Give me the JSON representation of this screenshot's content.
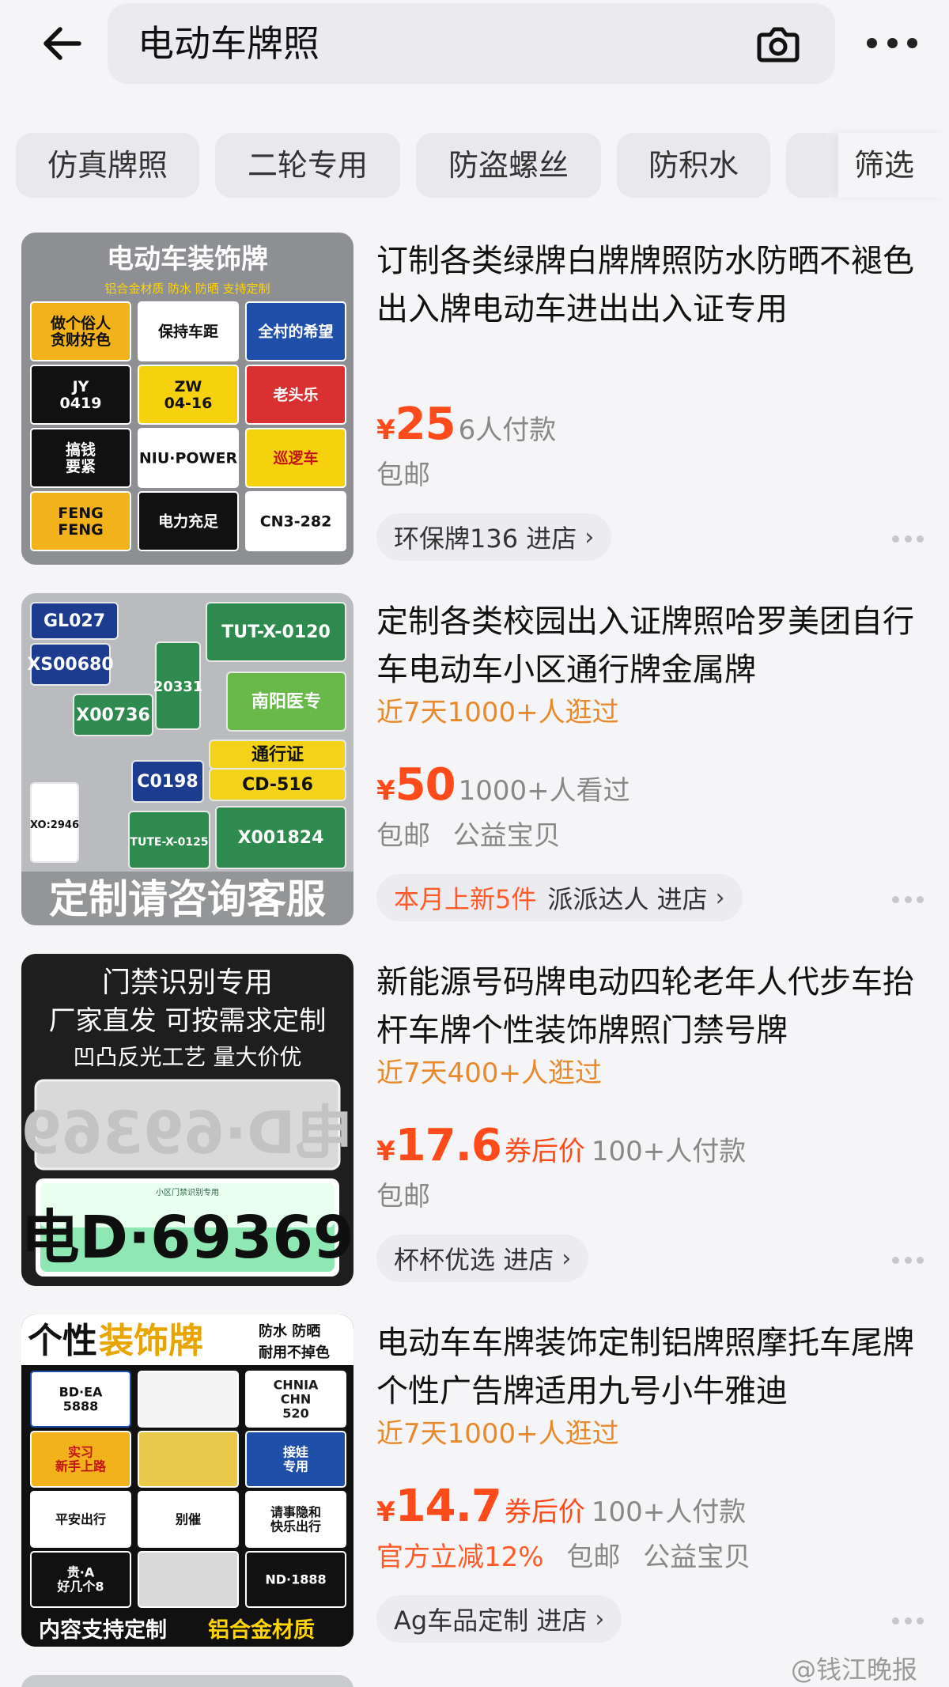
{
  "header": {
    "back_icon": "arrow-left-icon",
    "search_query": "电动车牌照",
    "camera_icon": "camera-icon",
    "more_icon": "more-horizontal-icon"
  },
  "filter_chips": [
    "仿真牌照",
    "二轮专用",
    "防盗螺丝",
    "防积水",
    "筛选"
  ],
  "products": [
    {
      "title": "订制各类绿牌白牌牌照防水防晒不褪色出入牌电动车进出出入证专用",
      "tagline": "",
      "price_yen": "¥",
      "price": "25",
      "coupon_label": "",
      "sales": "6人付款",
      "shipping": [
        "包邮"
      ],
      "shipping_highlight": "",
      "store_highlight": "",
      "store": "环保牌136",
      "store_link": "进店",
      "image": {
        "heading": "电动车装饰牌",
        "subheading": "铝合金材质 防水 防晒 支持定制",
        "plates": [
          "做个俗人 贪财好色",
          "保持车距",
          "全村的希望",
          "JY 0419",
          "ZW 04-16",
          "老头乐",
          "搞钱 要紧",
          "NIU·POWER",
          "巡逻车",
          "FENG FENG",
          "电力充足",
          "CN3-282"
        ]
      }
    },
    {
      "title": "定制各类校园出入证牌照哈罗美团自行车电动车小区通行牌金属牌",
      "tagline": "近7天1000+人逛过",
      "price_yen": "¥",
      "price": "50",
      "coupon_label": "",
      "sales": "1000+人看过",
      "shipping": [
        "包邮",
        "公益宝贝"
      ],
      "shipping_highlight": "",
      "store_highlight": "本月上新5件",
      "store": "派派达人",
      "store_link": "进店",
      "image": {
        "plates": [
          "GL027",
          "XS00680",
          "20331",
          "TUT-X-0120",
          "X00736",
          "南阳医专",
          "通行证",
          "CD-516",
          "C0198",
          "XO:2946",
          "TUTE-X-0125",
          "X001824"
        ],
        "banner": "定制请咨询客服"
      }
    },
    {
      "title": "新能源号码牌电动四轮老年人代步车抬杆车牌个性装饰牌照门禁号牌",
      "tagline": "近7天400+人逛过",
      "price_yen": "¥",
      "price": "17.6",
      "coupon_label": "券后价",
      "sales": "100+人付款",
      "shipping": [
        "包邮"
      ],
      "shipping_highlight": "",
      "store_highlight": "",
      "store": "杯杯优选",
      "store_link": "进店",
      "image": {
        "lines": [
          "门禁识别专用",
          "厂家直发 可按需求定制",
          "凹凸反光工艺 量大价优"
        ],
        "plate_text": "电D·69369",
        "plate_small": "小区门禁识别专用"
      }
    },
    {
      "title": "电动车车牌装饰定制铝牌照摩托车尾牌个性广告牌适用九号小牛雅迪",
      "tagline": "近7天1000+人逛过",
      "price_yen": "¥",
      "price": "14.7",
      "coupon_label": "券后价",
      "sales": "100+人付款",
      "shipping": [
        "包邮",
        "公益宝贝"
      ],
      "shipping_highlight": "官方立减12%",
      "store_highlight": "",
      "store": "Ag车品定制",
      "store_link": "进店",
      "image": {
        "heading_a": "个性",
        "heading_b": "装饰牌",
        "side_top": "防水 防晒",
        "side_bottom": "耐用不掉色",
        "plates": [
          "BD·EA 5888",
          "",
          "CHNIA CHN 520",
          "实习 新手上路",
          "",
          "接娃 专用",
          "平安出行",
          "别催",
          "请事隐和 快乐出行",
          "贵·A 好几个8",
          "",
          "ND·1888"
        ],
        "footer_a": "内容支持定制",
        "footer_b": "铝合金材质"
      }
    }
  ],
  "watermark": "@钱江晚报",
  "colors": {
    "accent": "#ff4a1c",
    "tagline": "#e88a2c",
    "muted": "#888888",
    "background": "#f5f5f7"
  }
}
